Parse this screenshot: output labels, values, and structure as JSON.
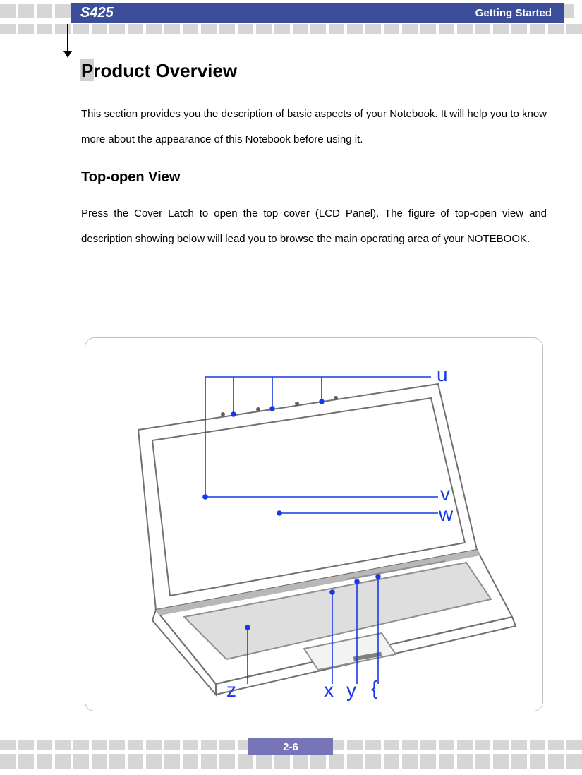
{
  "header": {
    "model": "S425",
    "section": "Getting  Started"
  },
  "h1": "Product Overview",
  "para1": "This section provides you the description of basic aspects of your Notebook.    It will help you to know more about the appearance of this Notebook before using it.",
  "h2": "Top-open View",
  "para2": "Press the Cover Latch to open the top cover (LCD Panel). The figure of top-open view and description showing below will lead you to browse the main operating area of your NOTEBOOK.",
  "figure": {
    "labels": {
      "u": "u",
      "v_upper": "v",
      "w": "w",
      "z": "z",
      "x": "x",
      "y_lower": "y",
      "brace": "{"
    }
  },
  "page_number": "2-6",
  "colors": {
    "header_bg": "#3c4e9a",
    "page_bg": "#7575b8",
    "callout": "#1838e8",
    "deco": "#d6d6d6"
  }
}
